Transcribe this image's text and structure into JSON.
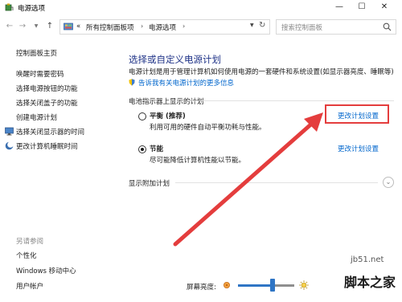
{
  "window": {
    "title": "电源选项",
    "minimize_glyph": "—",
    "maximize_glyph": "☐",
    "close_glyph": "✕"
  },
  "nav": {
    "back_glyph": "←",
    "forward_glyph": "→",
    "recent_glyph": "▼",
    "up_glyph": "↑",
    "breadcrumbs": [
      "«",
      "所有控制面板项",
      "›",
      "电源选项",
      "›"
    ],
    "dropdown_glyph": "▼",
    "refresh_glyph": "↻",
    "search_placeholder": "搜索控制面板"
  },
  "sidebar": {
    "items": [
      {
        "label": "控制面板主页"
      },
      {
        "label": "唤醒时需要密码"
      },
      {
        "label": "选择电源按钮的功能"
      },
      {
        "label": "选择关闭盖子的功能"
      },
      {
        "label": "创建电源计划"
      },
      {
        "label": "选择关闭显示器的时间"
      },
      {
        "label": "更改计算机睡眠时间"
      }
    ],
    "see_also_title": "另请参阅",
    "see_also": [
      {
        "label": "个性化"
      },
      {
        "label": "Windows 移动中心"
      },
      {
        "label": "用户帐户"
      }
    ]
  },
  "main": {
    "title": "选择或自定义电源计划",
    "description": "电源计划是用于管理计算机如何使用电源的一套硬件和系统设置(如显示器亮度、睡眠等)",
    "learn_more_link": "告诉我有关电源计划的更多信息",
    "group_label": "电池指示器上显示的计划",
    "plans": [
      {
        "name": "平衡 (推荐)",
        "description": "利用可用的硬件自动平衡功耗与性能。",
        "change_label": "更改计划设置",
        "selected": false
      },
      {
        "name": "节能",
        "description": "尽可能降低计算机性能以节能。",
        "change_label": "更改计划设置",
        "selected": true
      }
    ],
    "additional_plans_label": "显示附加计划",
    "expand_glyph": "⌄"
  },
  "brightness": {
    "label": "屏幕亮度:",
    "level": 0.62
  },
  "watermark": {
    "site": "jb51.net",
    "logo": "脚本之家"
  },
  "colors": {
    "title_blue": "#1e3287",
    "link_blue": "#0066cc",
    "annotation_red": "#e43d3d",
    "slider_blue": "#2f75c5"
  }
}
